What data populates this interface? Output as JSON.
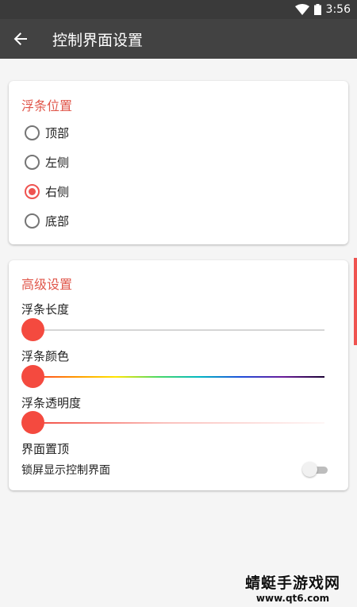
{
  "status_bar": {
    "time": "3:56",
    "icons": [
      "wifi-icon",
      "battery-icon"
    ]
  },
  "app_bar": {
    "title": "控制界面设置",
    "back_icon": "arrow-back-icon"
  },
  "float_position": {
    "title": "浮条位置",
    "options": [
      {
        "label": "顶部",
        "checked": false
      },
      {
        "label": "左侧",
        "checked": false
      },
      {
        "label": "右侧",
        "checked": true
      },
      {
        "label": "底部",
        "checked": false
      }
    ]
  },
  "advanced": {
    "title": "高级设置",
    "length": {
      "label": "浮条长度",
      "value": 0
    },
    "color": {
      "label": "浮条颜色",
      "value": 0
    },
    "opacity": {
      "label": "浮条透明度",
      "value": 0
    },
    "pin_top": {
      "label": "界面置顶"
    },
    "lockscreen": {
      "label": "锁屏显示控制界面",
      "enabled": false
    }
  },
  "watermark": {
    "main": "蜻蜓手游戏网",
    "sub": "www.qt6.com"
  },
  "colors": {
    "accent": "#ef5350",
    "app_bar": "#424242",
    "status_bar": "#3a3a3a"
  }
}
